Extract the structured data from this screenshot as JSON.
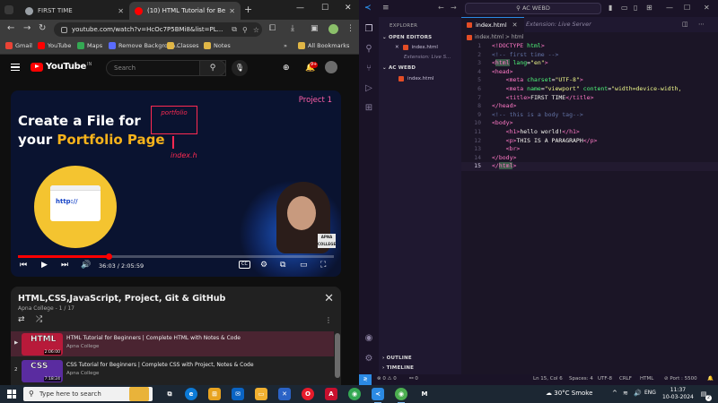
{
  "browser": {
    "tabs": [
      {
        "title": "FIRST TIME",
        "favicon_color": "#9aa0a6"
      },
      {
        "title": "(10) HTML Tutorial for Beginners",
        "favicon_color": "#ff0000"
      }
    ],
    "url": "youtube.com/watch?v=HcOc7P5BMi8&list=PL...",
    "bookmarks": [
      "Gmail",
      "YouTube",
      "Maps",
      "Remove Backgroun...",
      "Classes",
      "Notes"
    ],
    "all_bookmarks": "All Bookmarks"
  },
  "youtube": {
    "logo_text": "YouTube",
    "logo_region": "IN",
    "search_placeholder": "Search",
    "notification_count": "9+",
    "video": {
      "title_line1": "Create a File for",
      "title_line2_prefix": "your ",
      "title_line2_highlight": "Portfolio Page",
      "project_label": "Project 1",
      "sketch_label": "portfolio",
      "sketch_file": "index.h",
      "file_window_text": "http://",
      "brand_badge": "APNA COLLEGE",
      "time": "36:03 / 2:05:59",
      "progress_fraction": 0.286,
      "cc_label": "CC"
    },
    "playlist": {
      "title": "HTML,CSS,JavaScript, Project, Git & GitHub",
      "subtitle": "Apna College - 1 / 17",
      "items": [
        {
          "index": "▶",
          "thumb_word": "HTML",
          "duration": "2:06:00",
          "title": "HTML Tutorial for Beginners | Complete HTML with Notes & Code",
          "channel": "Apna College",
          "thumb_color": "#b81a3a",
          "active": true
        },
        {
          "index": "2",
          "thumb_word": "CSS",
          "duration": "7:18:24",
          "title": "CSS Tutorial for Beginners | Complete CSS with Project, Notes & Code",
          "channel": "Apna College",
          "thumb_color": "#5a2ca0",
          "active": false
        }
      ]
    }
  },
  "vscode": {
    "search_text": "AC WEBD",
    "explorer_header": "EXPLORER",
    "open_editors": "OPEN EDITORS",
    "open_files": [
      {
        "name": "index.html",
        "italic": false
      },
      {
        "name": "Extension: Live S...",
        "italic": true
      }
    ],
    "workspace": "AC WEBD",
    "workspace_files": [
      "index.html"
    ],
    "tab_active": "index.html",
    "tab_inactive": "Extension: Live Server",
    "breadcrumb_file": "index.html",
    "breadcrumb_sep": ">",
    "breadcrumb_node": "html",
    "current_line": 15,
    "outline": "OUTLINE",
    "timeline": "TIMELINE",
    "status": {
      "errors": "0",
      "warnings": "0",
      "ports": "0",
      "position": "Ln 15, Col 6",
      "spaces": "Spaces: 4",
      "encoding": "UTF-8",
      "eol": "CRLF",
      "language": "HTML",
      "port": "Port : 5500"
    }
  },
  "taskbar": {
    "search_placeholder": "Type here to search",
    "weather": "30°C Smoke",
    "language": "ENG",
    "time": "11:37",
    "date": "10-03-2024",
    "notifications": "2"
  }
}
